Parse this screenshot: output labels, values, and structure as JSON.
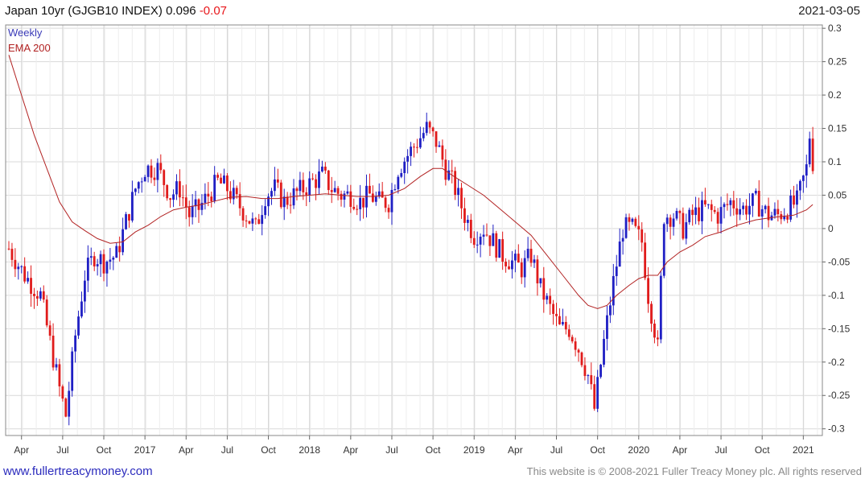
{
  "header": {
    "name": "Japan 10yr (GJGB10 INDEX)",
    "last": "0.096",
    "change": "-0.07",
    "date": "2021-03-05"
  },
  "footer": {
    "site": "www.fullertreacymoney.com",
    "copyright": "This website is © 2008-2021 Fuller Treacy Money plc. All rights reserved"
  },
  "colors": {
    "up": "#1f1fc4",
    "down": "#e01b1b",
    "ema": "#b22222",
    "grid": "#dcdcdc"
  },
  "chart_data": {
    "type": "candlestick",
    "legend": [
      "Weekly",
      "EMA 200"
    ],
    "legend_placement": "top-left",
    "grid": true,
    "y_axis_position": "right",
    "ylim": [
      -0.3,
      0.3
    ],
    "y_ticks": [
      0.3,
      0.25,
      0.2,
      0.15,
      0.1,
      0.05,
      0,
      -0.05,
      -0.1,
      -0.15,
      -0.2,
      -0.25,
      -0.3
    ],
    "y_tick_labels": [
      "0.3",
      "0.25",
      "0.2",
      "0.15",
      "0.1",
      "0.05",
      "0",
      "-0.05",
      "-0.1",
      "-0.15",
      "-0.2",
      "-0.25",
      "-0.3"
    ],
    "x_ticks": [
      "Apr",
      "Jul",
      "Oct",
      "2017",
      "Apr",
      "Jul",
      "Oct",
      "2018",
      "Apr",
      "Jul",
      "Oct",
      "2019",
      "Apr",
      "Jul",
      "Oct",
      "2020",
      "Apr",
      "Jul",
      "Oct",
      "2021"
    ],
    "x_tick_weeks": [
      4,
      17,
      30,
      43,
      56,
      69,
      82,
      95,
      108,
      121,
      134,
      147,
      160,
      173,
      186,
      199,
      212,
      225,
      238,
      251
    ],
    "close_anchors": [
      [
        0,
        -0.03
      ],
      [
        5,
        -0.07
      ],
      [
        10,
        -0.1
      ],
      [
        13,
        -0.17
      ],
      [
        16,
        -0.24
      ],
      [
        18,
        -0.28
      ],
      [
        21,
        -0.16
      ],
      [
        24,
        -0.07
      ],
      [
        27,
        -0.04
      ],
      [
        30,
        -0.05
      ],
      [
        34,
        -0.04
      ],
      [
        37,
        0.01
      ],
      [
        40,
        0.06
      ],
      [
        43,
        0.09
      ],
      [
        47,
        0.09
      ],
      [
        51,
        0.05
      ],
      [
        54,
        0.06
      ],
      [
        57,
        0.02
      ],
      [
        60,
        0.03
      ],
      [
        63,
        0.05
      ],
      [
        66,
        0.07
      ],
      [
        69,
        0.06
      ],
      [
        72,
        0.04
      ],
      [
        75,
        0.02
      ],
      [
        78,
        0.0
      ],
      [
        81,
        0.05
      ],
      [
        84,
        0.06
      ],
      [
        87,
        0.04
      ],
      [
        90,
        0.05
      ],
      [
        93,
        0.06
      ],
      [
        96,
        0.07
      ],
      [
        99,
        0.08
      ],
      [
        102,
        0.06
      ],
      [
        105,
        0.05
      ],
      [
        108,
        0.05
      ],
      [
        111,
        0.04
      ],
      [
        114,
        0.05
      ],
      [
        117,
        0.04
      ],
      [
        120,
        0.04
      ],
      [
        123,
        0.09
      ],
      [
        126,
        0.11
      ],
      [
        129,
        0.13
      ],
      [
        132,
        0.15
      ],
      [
        135,
        0.13
      ],
      [
        138,
        0.09
      ],
      [
        141,
        0.06
      ],
      [
        144,
        0.02
      ],
      [
        147,
        -0.01
      ],
      [
        150,
        0.0
      ],
      [
        153,
        -0.02
      ],
      [
        156,
        -0.04
      ],
      [
        159,
        -0.05
      ],
      [
        162,
        -0.06
      ],
      [
        165,
        -0.04
      ],
      [
        168,
        -0.09
      ],
      [
        171,
        -0.12
      ],
      [
        174,
        -0.15
      ],
      [
        177,
        -0.15
      ],
      [
        180,
        -0.18
      ],
      [
        183,
        -0.22
      ],
      [
        185,
        -0.27
      ],
      [
        188,
        -0.17
      ],
      [
        191,
        -0.08
      ],
      [
        194,
        0.0
      ],
      [
        197,
        0.0
      ],
      [
        200,
        -0.02
      ],
      [
        202,
        -0.1
      ],
      [
        204,
        -0.15
      ],
      [
        205,
        -0.18
      ],
      [
        207,
        0.02
      ],
      [
        210,
        0.02
      ],
      [
        213,
        0.0
      ],
      [
        216,
        0.02
      ],
      [
        220,
        0.03
      ],
      [
        224,
        0.02
      ],
      [
        228,
        0.04
      ],
      [
        232,
        0.03
      ],
      [
        236,
        0.04
      ],
      [
        240,
        0.02
      ],
      [
        243,
        0.02
      ],
      [
        246,
        0.03
      ],
      [
        249,
        0.04
      ],
      [
        252,
        0.09
      ],
      [
        253,
        0.14
      ],
      [
        254,
        0.1
      ]
    ],
    "ema_anchors": [
      [
        0,
        0.26
      ],
      [
        4,
        0.2
      ],
      [
        8,
        0.14
      ],
      [
        12,
        0.09
      ],
      [
        16,
        0.04
      ],
      [
        20,
        0.01
      ],
      [
        24,
        -0.003
      ],
      [
        28,
        -0.015
      ],
      [
        32,
        -0.022
      ],
      [
        36,
        -0.02
      ],
      [
        40,
        -0.005
      ],
      [
        44,
        0.005
      ],
      [
        48,
        0.018
      ],
      [
        52,
        0.028
      ],
      [
        56,
        0.032
      ],
      [
        60,
        0.035
      ],
      [
        64,
        0.04
      ],
      [
        70,
        0.047
      ],
      [
        75,
        0.048
      ],
      [
        80,
        0.045
      ],
      [
        85,
        0.045
      ],
      [
        90,
        0.048
      ],
      [
        95,
        0.05
      ],
      [
        100,
        0.052
      ],
      [
        105,
        0.05
      ],
      [
        110,
        0.048
      ],
      [
        115,
        0.048
      ],
      [
        120,
        0.05
      ],
      [
        125,
        0.06
      ],
      [
        130,
        0.078
      ],
      [
        134,
        0.09
      ],
      [
        137,
        0.09
      ],
      [
        140,
        0.08
      ],
      [
        145,
        0.065
      ],
      [
        150,
        0.05
      ],
      [
        155,
        0.03
      ],
      [
        160,
        0.01
      ],
      [
        165,
        -0.01
      ],
      [
        170,
        -0.04
      ],
      [
        175,
        -0.07
      ],
      [
        180,
        -0.1
      ],
      [
        183,
        -0.115
      ],
      [
        186,
        -0.12
      ],
      [
        189,
        -0.115
      ],
      [
        192,
        -0.1
      ],
      [
        196,
        -0.085
      ],
      [
        199,
        -0.075
      ],
      [
        202,
        -0.07
      ],
      [
        205,
        -0.07
      ],
      [
        208,
        -0.05
      ],
      [
        212,
        -0.035
      ],
      [
        216,
        -0.025
      ],
      [
        220,
        -0.012
      ],
      [
        225,
        -0.005
      ],
      [
        230,
        0.005
      ],
      [
        236,
        0.013
      ],
      [
        242,
        0.017
      ],
      [
        248,
        0.02
      ],
      [
        252,
        0.028
      ],
      [
        254,
        0.036
      ]
    ]
  }
}
